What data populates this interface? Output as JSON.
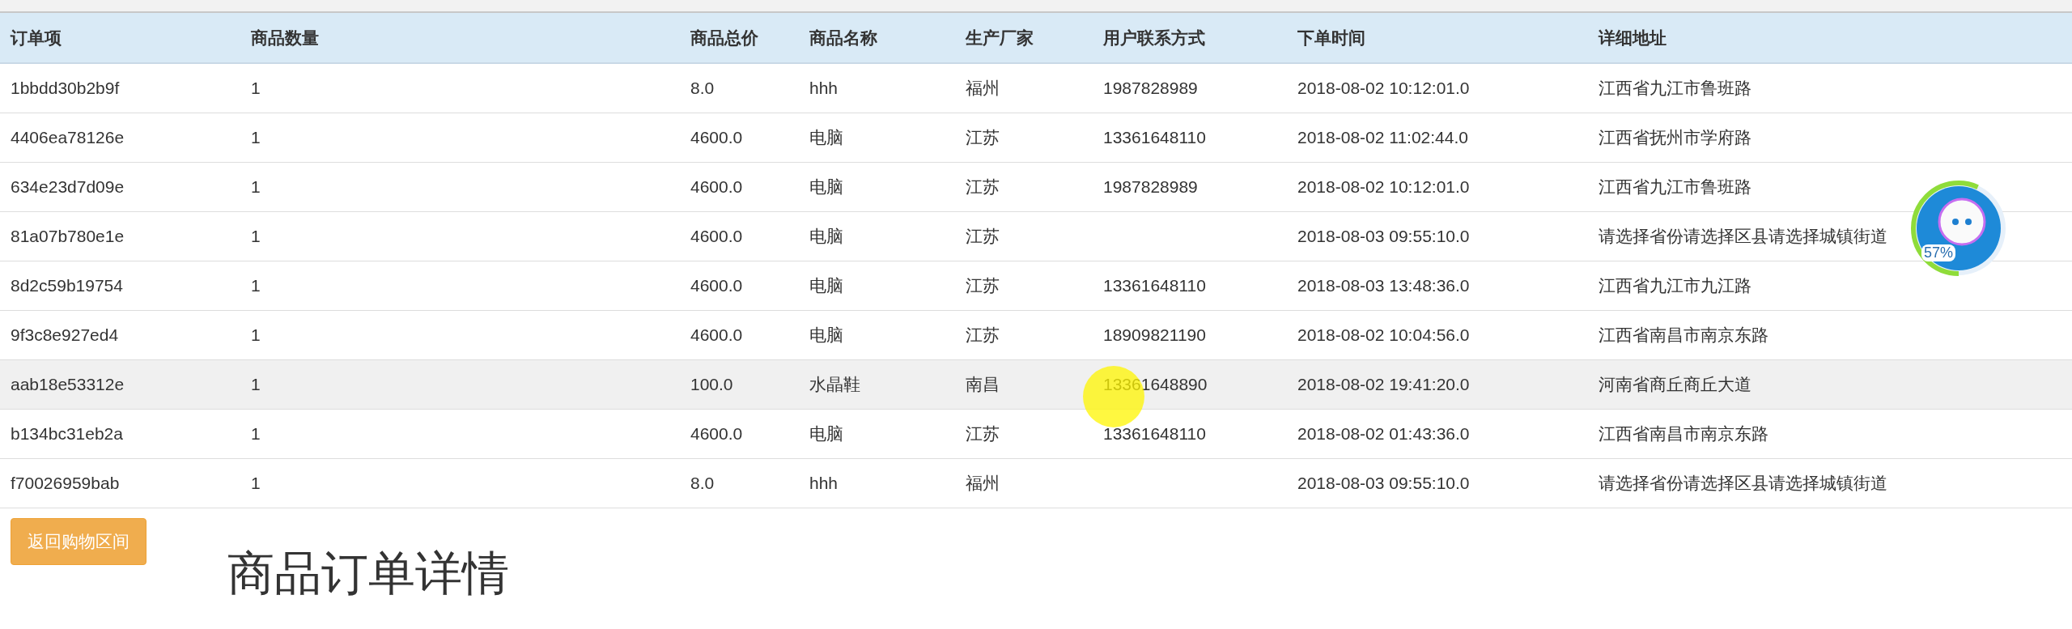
{
  "table": {
    "columns": [
      "订单项",
      "商品数量",
      "商品总价",
      "商品名称",
      "生产厂家",
      "用户联系方式",
      "下单时间",
      "详细地址"
    ],
    "rows": [
      {
        "highlighted": false,
        "cells": [
          "1bbdd30b2b9f",
          "1",
          "8.0",
          "hhh",
          "福州",
          "1987828989",
          "2018-08-02 10:12:01.0",
          "江西省九江市鲁班路"
        ]
      },
      {
        "highlighted": false,
        "cells": [
          "4406ea78126e",
          "1",
          "4600.0",
          "电脑",
          "江苏",
          "13361648110",
          "2018-08-02 11:02:44.0",
          "江西省抚州市学府路"
        ]
      },
      {
        "highlighted": false,
        "cells": [
          "634e23d7d09e",
          "1",
          "4600.0",
          "电脑",
          "江苏",
          "1987828989",
          "2018-08-02 10:12:01.0",
          "江西省九江市鲁班路"
        ]
      },
      {
        "highlighted": false,
        "cells": [
          "81a07b780e1e",
          "1",
          "4600.0",
          "电脑",
          "江苏",
          "",
          "2018-08-03 09:55:10.0",
          "请选择省份请选择区县请选择城镇街道"
        ]
      },
      {
        "highlighted": false,
        "cells": [
          "8d2c59b19754",
          "1",
          "4600.0",
          "电脑",
          "江苏",
          "13361648110",
          "2018-08-03 13:48:36.0",
          "江西省九江市九江路"
        ]
      },
      {
        "highlighted": false,
        "cells": [
          "9f3c8e927ed4",
          "1",
          "4600.0",
          "电脑",
          "江苏",
          "18909821190",
          "2018-08-02 10:04:56.0",
          "江西省南昌市南京东路"
        ]
      },
      {
        "highlighted": true,
        "cells": [
          "aab18e53312e",
          "1",
          "100.0",
          "水晶鞋",
          "南昌",
          "13361648890",
          "2018-08-02 19:41:20.0",
          "河南省商丘商丘大道"
        ]
      },
      {
        "highlighted": false,
        "cells": [
          "b134bc31eb2a",
          "1",
          "4600.0",
          "电脑",
          "江苏",
          "13361648110",
          "2018-08-02 01:43:36.0",
          "江西省南昌市南京东路"
        ]
      },
      {
        "highlighted": false,
        "cells": [
          "f70026959bab",
          "1",
          "8.0",
          "hhh",
          "福州",
          "",
          "2018-08-03 09:55:10.0",
          "请选择省份请选择区县请选择城镇街道"
        ]
      }
    ]
  },
  "back_button": "返回购物区间",
  "heading": "商品订单详情",
  "widget": {
    "reading": "57%"
  }
}
